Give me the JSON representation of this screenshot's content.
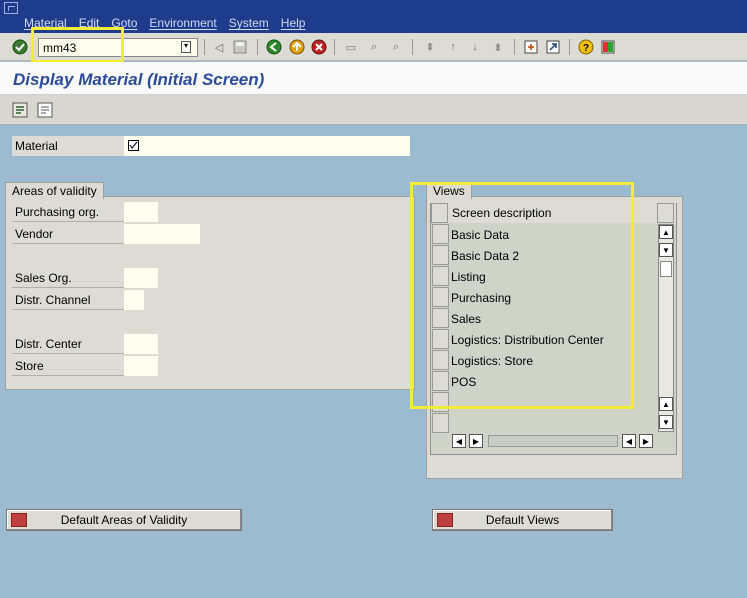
{
  "menu": [
    "Material",
    "Edit",
    "Goto",
    "Environment",
    "System",
    "Help"
  ],
  "command_field": "mm43",
  "title": "Display Material (Initial Screen)",
  "material_label": "Material",
  "areas_of_validity": {
    "title": "Areas of validity",
    "fields": [
      "Purchasing org.",
      "Vendor",
      "Sales Org.",
      "Distr. Channel",
      "Distr. Center",
      "Store"
    ]
  },
  "views": {
    "title": "Views",
    "column_header": "Screen description",
    "rows": [
      "Basic Data",
      "Basic Data 2",
      "Listing",
      "Purchasing",
      "Sales",
      "Logistics: Distribution Center",
      "Logistics: Store",
      "POS"
    ]
  },
  "buttons": {
    "default_areas": "Default Areas of Validity",
    "default_views": "Default Views"
  },
  "colors": {
    "menu_bg": "#1f3c8c",
    "title": "#2a4c9a",
    "highlight": "#f2ee36",
    "screen_bg": "#9cbad0"
  }
}
